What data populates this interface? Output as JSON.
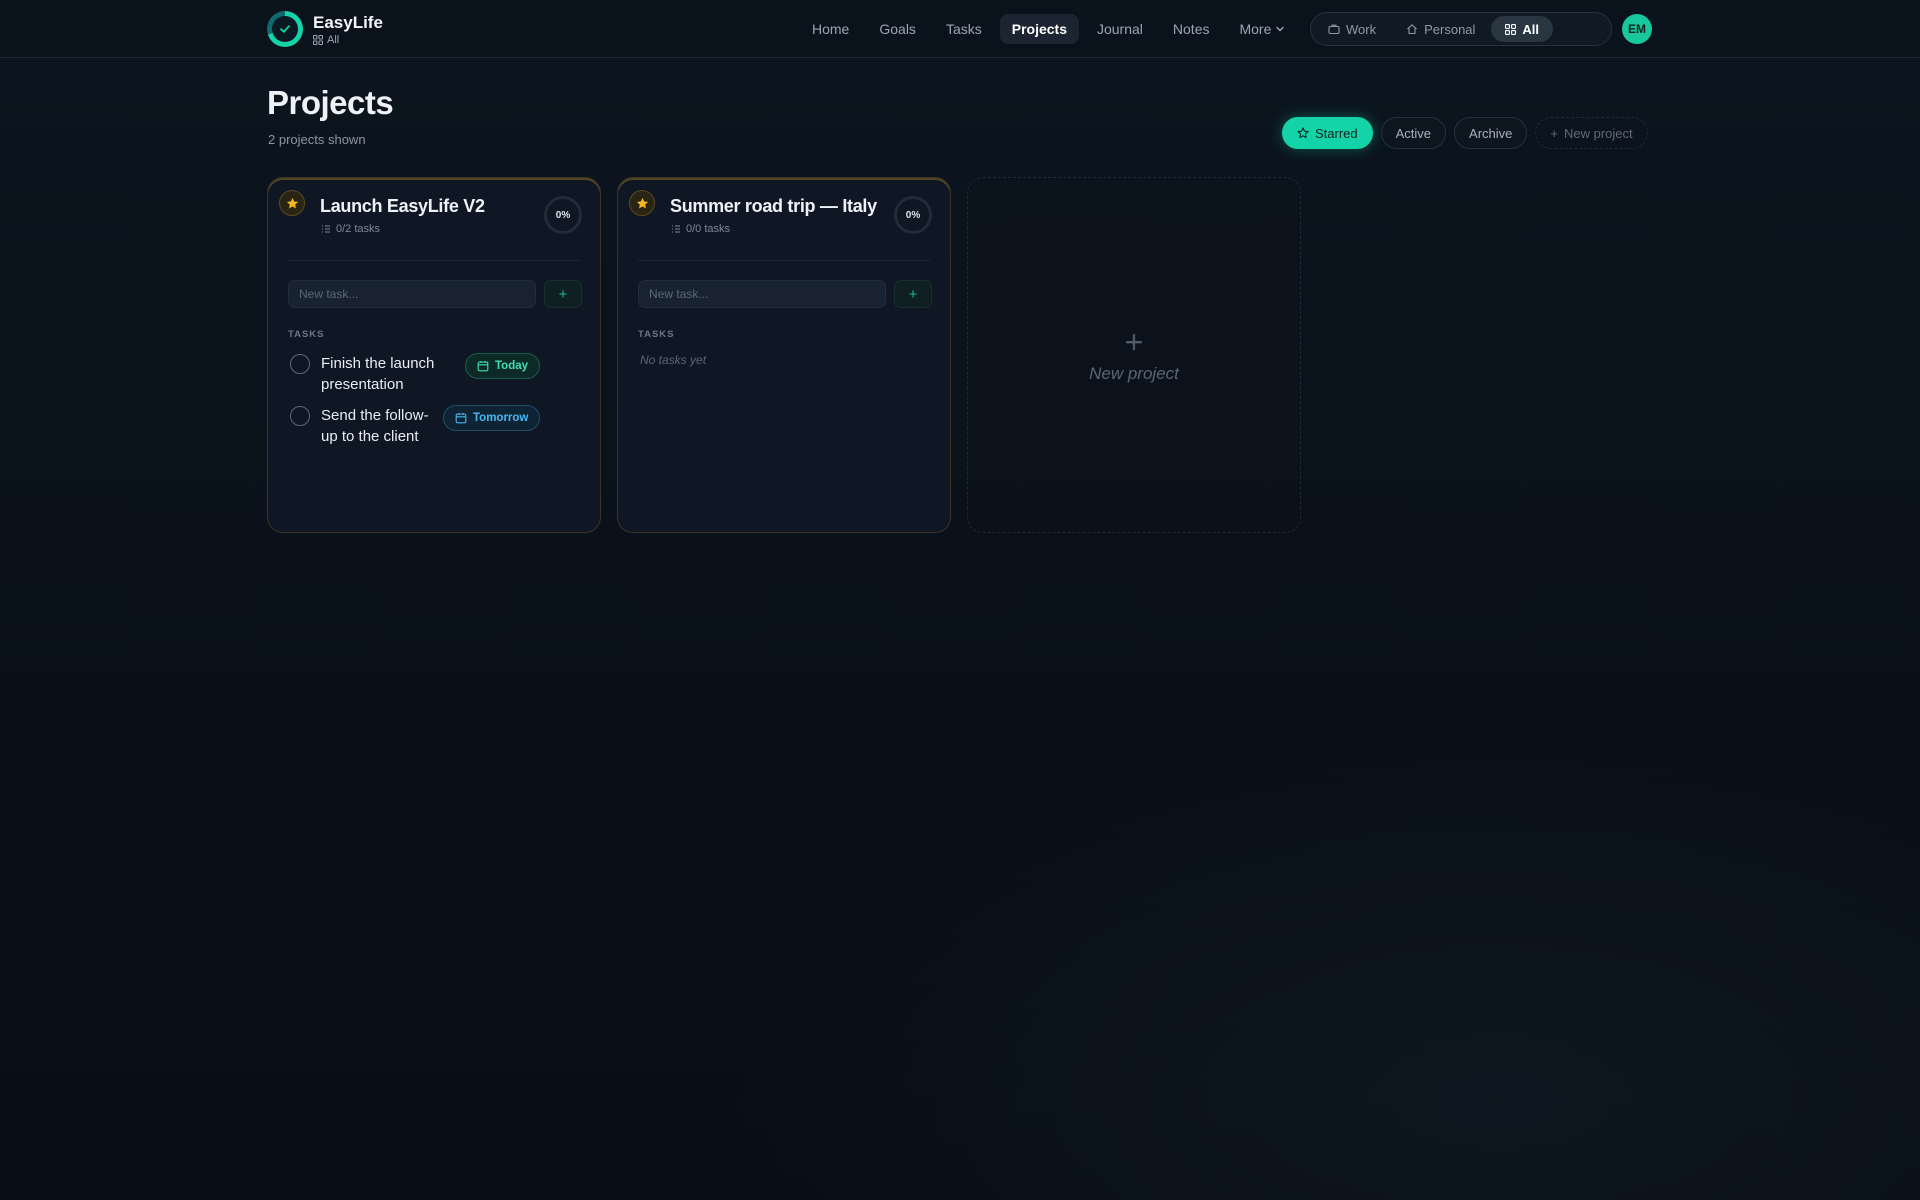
{
  "brand": {
    "name": "EasyLife",
    "context": "All"
  },
  "nav": [
    {
      "label": "Home",
      "active": false
    },
    {
      "label": "Goals",
      "active": false
    },
    {
      "label": "Tasks",
      "active": false
    },
    {
      "label": "Projects",
      "active": true
    },
    {
      "label": "Journal",
      "active": false
    },
    {
      "label": "Notes",
      "active": false
    },
    {
      "label": "More",
      "active": false
    }
  ],
  "context_switch": [
    {
      "label": "Work",
      "icon": "briefcase-icon",
      "active": false
    },
    {
      "label": "Personal",
      "icon": "home-icon",
      "active": false
    },
    {
      "label": "All",
      "icon": "grid-icon",
      "active": true
    }
  ],
  "user": {
    "initials": "EM"
  },
  "page": {
    "title": "Projects",
    "subtitle": "2 projects shown"
  },
  "filters": {
    "starred": "Starred",
    "active": "Active",
    "archive": "Archive",
    "new_project": "New project"
  },
  "projects": [
    {
      "title": "Launch EasyLife V2",
      "meta": "0/2 tasks",
      "progress": "0%",
      "starred": true,
      "task_placeholder": "New task...",
      "section_label": "TASKS",
      "tasks": [
        {
          "text": "Finish the launch presentation",
          "due": "Today"
        },
        {
          "text": "Send the follow-up to the client",
          "due": "Tomorrow"
        }
      ]
    },
    {
      "title": "Summer road trip — Italy",
      "meta": "0/0 tasks",
      "progress": "0%",
      "starred": true,
      "task_placeholder": "New task...",
      "section_label": "TASKS",
      "empty_text": "No tasks yet",
      "tasks": []
    }
  ],
  "new_project_card": {
    "plus": "+",
    "label": "New project"
  },
  "colors": {
    "accent": "#14d3a8",
    "star": "#f5b820",
    "today": "#3fe0b6",
    "tomorrow": "#4ab6f0"
  }
}
